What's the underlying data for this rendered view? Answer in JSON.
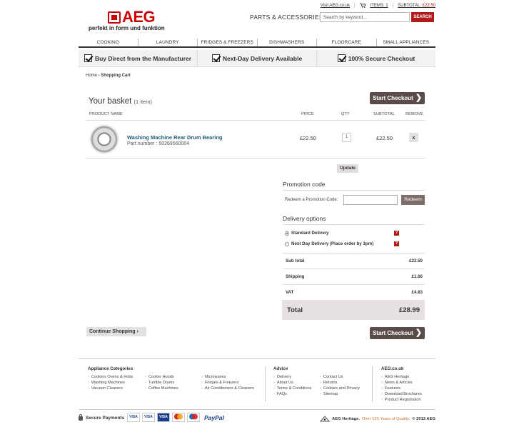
{
  "header": {
    "logo_text": "AEG",
    "tagline": "perfekt in form und funktion",
    "visit_link": "Visit AEG.co.uk",
    "items_label": "ITEMS: 1",
    "subtotal_label": "SUBTOTAL:",
    "subtotal_value": "£22.50",
    "section_title": "PARTS & ACCESSORIES",
    "search_placeholder": "Search by keyword...",
    "search_button": "SEARCH"
  },
  "nav": [
    "COOKING",
    "LAUNDRY",
    "FRIDGES & FREEZERS",
    "DISHWASHERS",
    "FLOORCARE",
    "SMALL APPLIANCES"
  ],
  "benefits": [
    "Buy Direct from the Manufacturer",
    "Next-Day Delivery Available",
    "100% Secure Checkout"
  ],
  "breadcrumb": {
    "home": "Home",
    "separator": "›",
    "current": "Shopping Cart"
  },
  "basket": {
    "title": "Your basket",
    "count": "(1 item)",
    "checkout_label": "Start Checkout",
    "columns": {
      "product": "PRODUCT NAME",
      "price": "PRICE",
      "qty": "QTY",
      "subtotal": "SUBTOTAL",
      "remove": "REMOVE"
    },
    "item": {
      "name": "Washing Machine Rear Drum Bearing",
      "part_number": "Part number : 50269560004",
      "price": "£22.50",
      "qty": "1",
      "subtotal": "£22.50",
      "remove": "x"
    },
    "update_label": "Update"
  },
  "promo": {
    "title": "Promotion code",
    "label": "Redeem a Promotion Code:",
    "input_value": "",
    "button": "Redeem"
  },
  "delivery": {
    "title": "Delivery options",
    "options": [
      {
        "label": "Standard Delivery",
        "selected": true
      },
      {
        "label": "Next Day Delivery (Place order by 3pm)",
        "selected": false
      }
    ],
    "help": "?"
  },
  "summary": {
    "rows": [
      {
        "label": "Sub total",
        "value": "£22.50"
      },
      {
        "label": "Shipping",
        "value": "£1.66"
      },
      {
        "label": "VAT",
        "value": "£4.83"
      }
    ],
    "total_label": "Total",
    "total_value": "£28.99"
  },
  "continue_label": "Continue Shopping",
  "footer": {
    "appliance_title": "Appliance Categories",
    "col1": [
      "Cookers Ovens & Hobs",
      "Washing Machines",
      "Vacuum Cleaners"
    ],
    "col2": [
      "Cooker Hoods",
      "Tumble Dryers",
      "Coffee Machines"
    ],
    "col3": [
      "Microwaves",
      "Fridges & Freezers",
      "Air Conditioners & Cleaners"
    ],
    "advice_title": "Advice",
    "advice1": [
      "Delivery",
      "About Us",
      "Terms & Conditions",
      "FAQs"
    ],
    "advice2": [
      "Contact Us",
      "Returns",
      "Cookies and Privacy",
      "Sitemap"
    ],
    "aeg_title": "AEG.co.uk",
    "aeg_links": [
      "AEG Heritage",
      "News & Articles",
      "Features",
      "Download Brochures",
      "Product Registration"
    ],
    "secure_label": "Secure Payments",
    "secure_sep": "|",
    "cards": [
      "VISA",
      "VISA",
      "VISA",
      "MC",
      "MAE"
    ],
    "paypal": "PayPal",
    "heritage_prefix": "AEG Heritage.",
    "heritage_highlight": "Over 120 Years of Quality.",
    "heritage_copy": "© 2013 AEG"
  },
  "colors": {
    "brand_red": "#c00",
    "checkout_bg": "#5a4c48",
    "link_blue": "#1f5a76"
  }
}
